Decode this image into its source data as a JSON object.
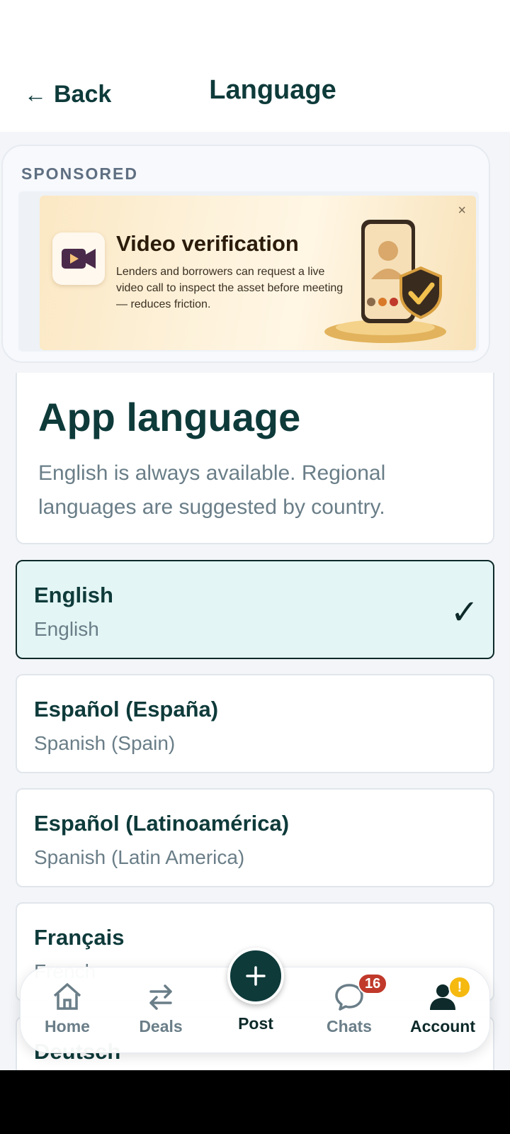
{
  "header": {
    "back_label": "Back",
    "title": "Language"
  },
  "sponsored": {
    "label": "SPONSORED",
    "ad": {
      "title": "Video verification",
      "body": "Lenders and borrowers can request a live video call to inspect the asset before meeting — reduces friction.",
      "icon": "video-camera-icon",
      "close_symbol": "×"
    }
  },
  "info": {
    "title": "App language",
    "description": "English is always available. Regional languages are suggested by country."
  },
  "languages": [
    {
      "name": "English",
      "native": "English",
      "selected": true
    },
    {
      "name": "Español (España)",
      "native": "Spanish (Spain)",
      "selected": false
    },
    {
      "name": "Español (Latinoamérica)",
      "native": "Spanish (Latin America)",
      "selected": false
    },
    {
      "name": "Français",
      "native": "French",
      "selected": false
    },
    {
      "name": "Deutsch",
      "native": "",
      "selected": false
    }
  ],
  "checkmark": "✓",
  "nav": {
    "home": "Home",
    "deals": "Deals",
    "post": "Post",
    "chats": "Chats",
    "chats_badge": "16",
    "account": "Account",
    "account_badge": "!"
  },
  "colors": {
    "brand": "#0e3a3a",
    "selected_bg": "#e3f5f4",
    "badge_red": "#c0392b",
    "alert_yellow": "#f5b90f"
  }
}
